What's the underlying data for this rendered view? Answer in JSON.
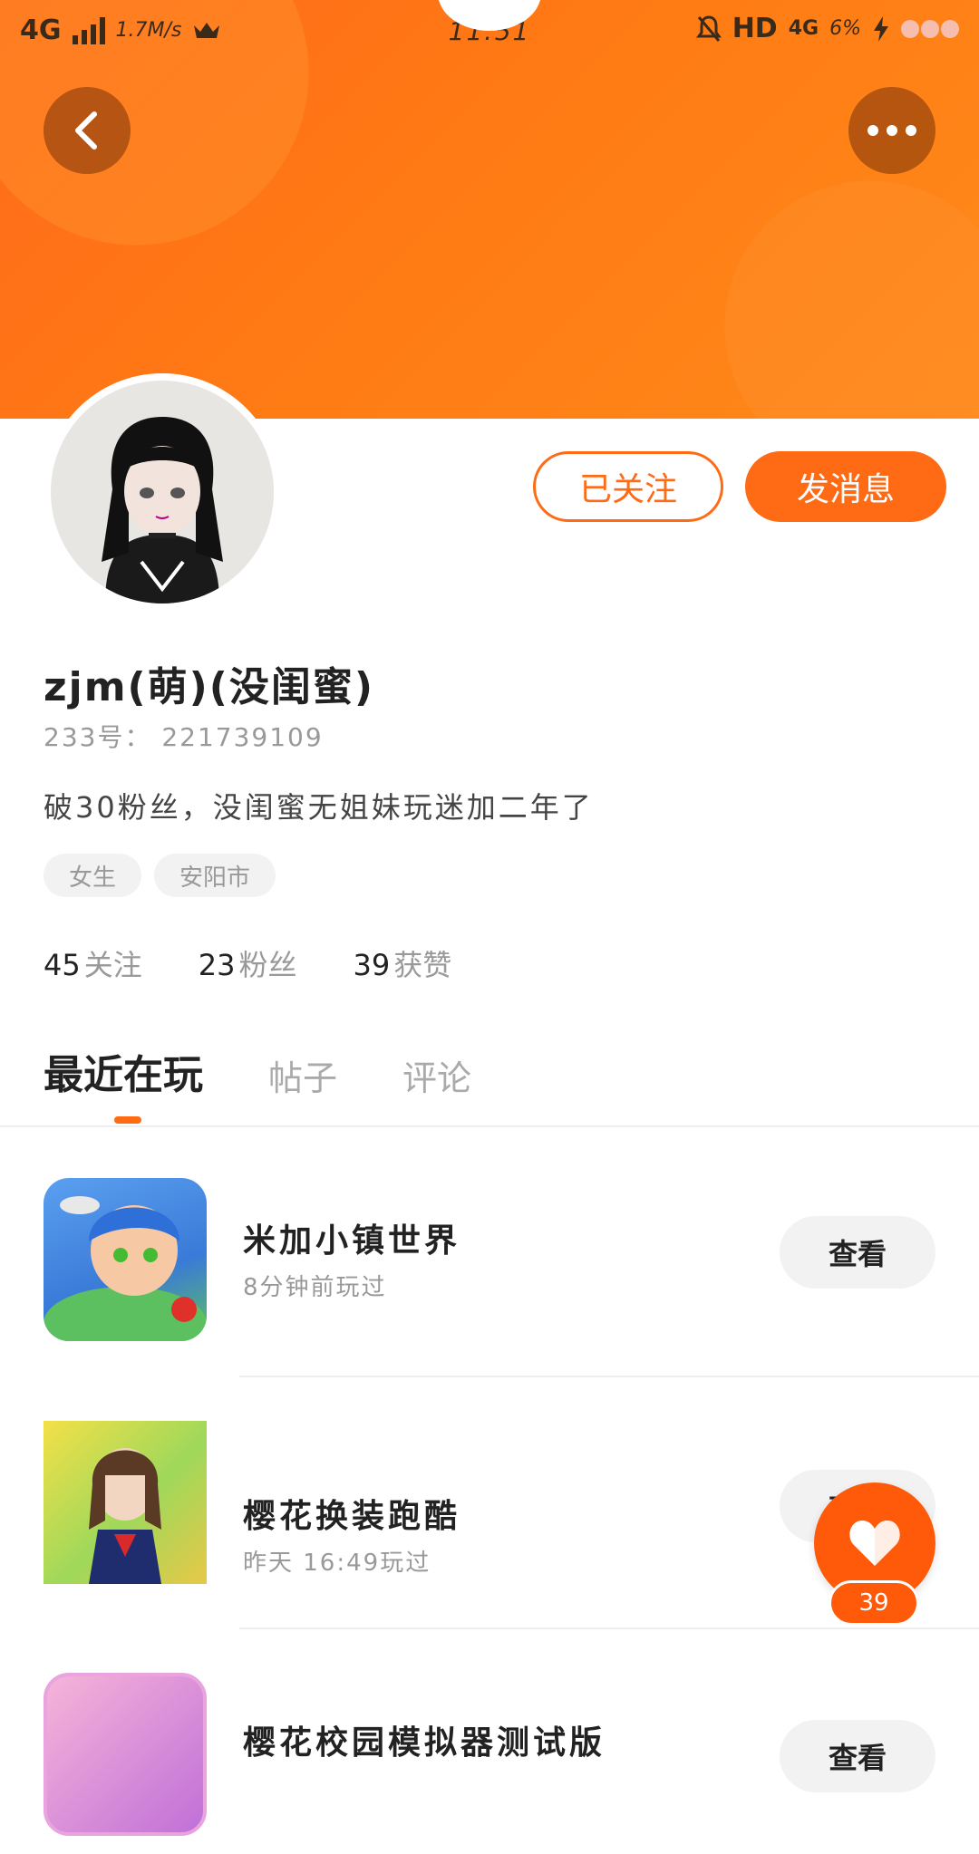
{
  "status_bar": {
    "network": "4G",
    "speed": "1.7M/s",
    "time": "11:51",
    "hd": "HD",
    "network_right": "4G",
    "battery": "6%"
  },
  "profile": {
    "follow_button": "已关注",
    "message_button": "发消息",
    "username": "zjm(萌)(没闺蜜)",
    "user_id": "233号： 221739109",
    "bio": "破30粉丝，没闺蜜无姐妹玩迷加二年了",
    "tags": [
      "女生",
      "安阳市"
    ]
  },
  "stats": [
    {
      "num": "45",
      "label": "关注"
    },
    {
      "num": "23",
      "label": "粉丝"
    },
    {
      "num": "39",
      "label": "获赞"
    }
  ],
  "tabs": [
    "最近在玩",
    "帖子",
    "评论"
  ],
  "games": [
    {
      "title": "米加小镇世界",
      "time": "8分钟前玩过",
      "action": "查看"
    },
    {
      "title": "樱花换装跑酷",
      "time": "昨天 16:49玩过",
      "action": "查看"
    },
    {
      "title": "樱花校园模拟器测试版",
      "time": "",
      "action": "查看"
    }
  ],
  "like": {
    "count": "39"
  },
  "colors": {
    "accent": "#ff6a14",
    "banner": "#ff7a14"
  }
}
